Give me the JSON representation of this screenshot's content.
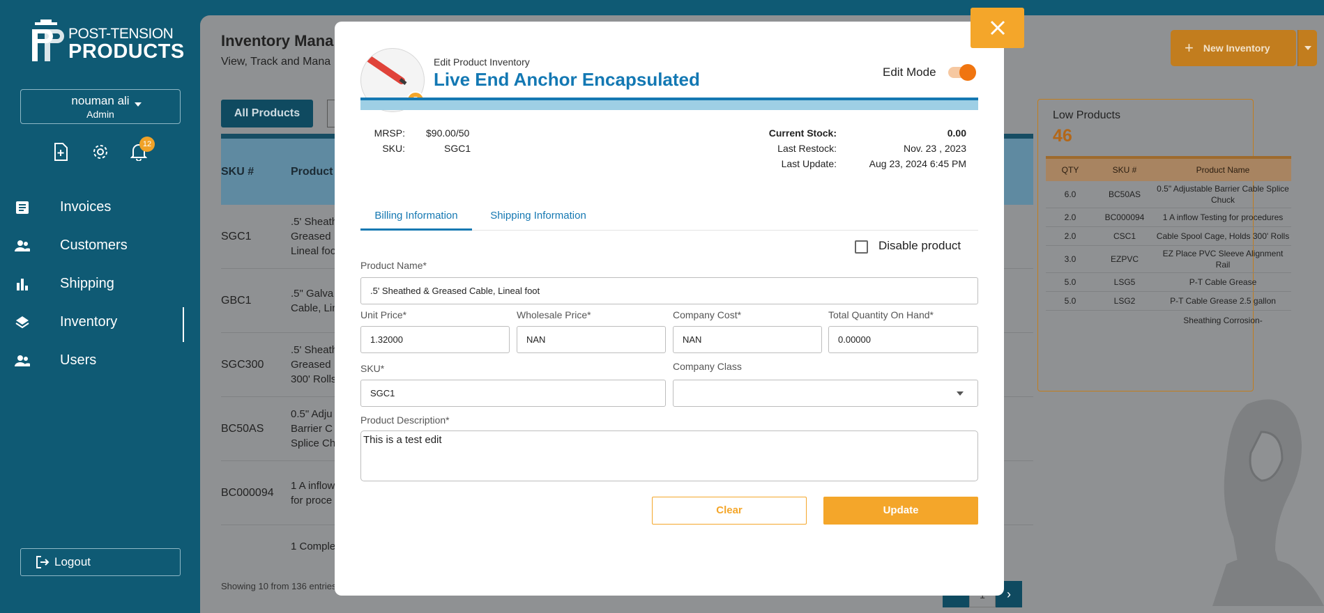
{
  "sidebar": {
    "logo_line1": "POST-TENSION",
    "logo_line2": "PRODUCTS",
    "user_name": "nouman ali",
    "user_role": "Admin",
    "notification_count": "12",
    "nav": [
      {
        "label": "Invoices"
      },
      {
        "label": "Customers"
      },
      {
        "label": "Shipping"
      },
      {
        "label": "Inventory"
      },
      {
        "label": "Users"
      }
    ],
    "active_item": "Inventory",
    "logout_label": "Logout"
  },
  "page": {
    "title": "Inventory Mana",
    "subtitle": "View, Track and Mana",
    "new_button_label": "New Inventory",
    "tab_all_label": "All Products",
    "table_headers": [
      "SKU #",
      "Product"
    ],
    "rows": [
      {
        "sku": "SGC1",
        "name": ".5' Sheath Greased Lineal foo"
      },
      {
        "sku": "GBC1",
        "name": ".5\" Galva Cable, Lin"
      },
      {
        "sku": "SGC300",
        "name": ".5' Sheath Greased 300' Rolls"
      },
      {
        "sku": "BC50AS",
        "name": "0.5\" Adju Barrier C Splice Ch"
      },
      {
        "sku": "BC000094",
        "name": "1 A inflow for proce"
      },
      {
        "sku": "",
        "name": "1 Comple"
      }
    ],
    "showing_text": "Showing 10 from 136 entries",
    "current_page": "1"
  },
  "low_products": {
    "title": "Low Products",
    "count": "46",
    "headers": [
      "QTY",
      "SKU #",
      "Product Name"
    ],
    "rows": [
      {
        "qty": "6.0",
        "sku": "BC50AS",
        "name": "0.5\" Adjustable Barrier Cable Splice Chuck"
      },
      {
        "qty": "2.0",
        "sku": "BC000094",
        "name": "1 A inflow Testing for procedures"
      },
      {
        "qty": "2.0",
        "sku": "CSC1",
        "name": "Cable Spool Cage, Holds 300' Rolls"
      },
      {
        "qty": "3.0",
        "sku": "EZPVC",
        "name": "EZ Place PVC Sleeve Alignment Rail"
      },
      {
        "qty": "5.0",
        "sku": "LSG5",
        "name": "P-T Cable Grease"
      },
      {
        "qty": "5.0",
        "sku": "LSG2",
        "name": "P-T Cable Grease 2.5 gallon"
      },
      {
        "qty": "",
        "sku": "",
        "name": "Sheathing Corrosion-"
      }
    ]
  },
  "modal": {
    "sup_title": "Edit Product Inventory",
    "title": "Live End Anchor Encapsulated",
    "edit_mode_label": "Edit Mode",
    "edit_mode_on": true,
    "mrsp_label": "MRSP:",
    "mrsp_value": "$90.00/50",
    "sku_label": "SKU:",
    "sku_value": "SGC1",
    "current_stock_label": "Current Stock:",
    "current_stock_value": "0.00",
    "last_restock_label": "Last Restock:",
    "last_restock_value": "Nov. 23 , 2023",
    "last_update_label": "Last Update:",
    "last_update_value": "Aug 23, 2024 6:45 PM",
    "tabs": [
      "Billing Information",
      "Shipping Information"
    ],
    "disable_label": "Disable product",
    "fields": {
      "product_name_label": "Product Name*",
      "product_name_value": ".5' Sheathed & Greased Cable, Lineal foot",
      "unit_price_label": "Unit Price*",
      "unit_price_value": "1.32000",
      "wholesale_label": "Wholesale Price*",
      "wholesale_value": "NAN",
      "company_cost_label": "Company Cost*",
      "company_cost_value": "NAN",
      "total_qty_label": "Total Quantity On Hand*",
      "total_qty_value": "0.00000",
      "sku_label": "SKU*",
      "sku_value": "SGC1",
      "company_class_label": "Company Class",
      "company_class_value": "",
      "description_label": "Product Description*",
      "description_value": "This is a test edit"
    },
    "clear_label": "Clear",
    "update_label": "Update"
  },
  "colors": {
    "sidebar": "#0f5a74",
    "accent_orange": "#f4a62a",
    "title_blue": "#1378b3",
    "toggle": "#f07510"
  },
  "icons": [
    "add-invoice-icon",
    "gear-icon",
    "bell-icon",
    "invoice-icon",
    "customers-icon",
    "shipping-chart-icon",
    "inventory-layers-icon",
    "users-icon",
    "logout-icon",
    "close-icon",
    "camera-icon",
    "plus-icon",
    "chevron-down-icon"
  ]
}
